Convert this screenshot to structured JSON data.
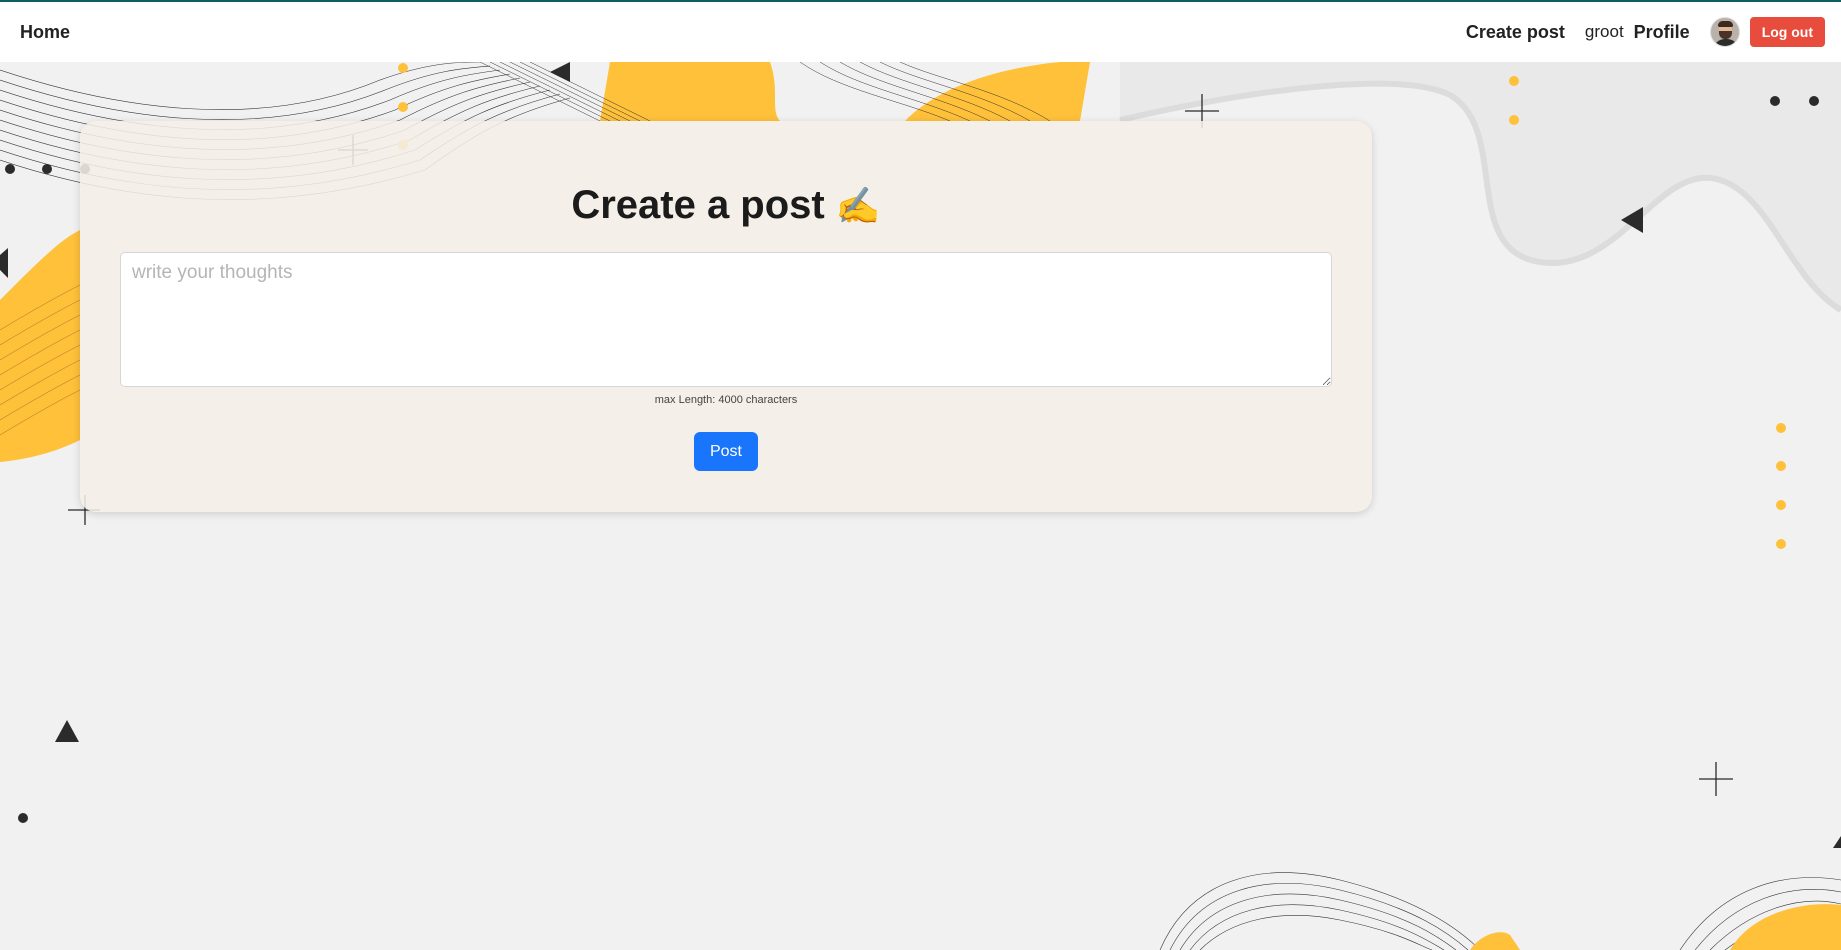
{
  "nav": {
    "home_label": "Home",
    "create_post_label": "Create post",
    "username": "groot",
    "profile_label": "Profile",
    "logout_label": "Log out"
  },
  "composer": {
    "title": "Create a post",
    "title_emoji": "✍",
    "textarea_placeholder": "write your thoughts",
    "textarea_value": "",
    "hint": "max Length: 4000 characters",
    "submit_label": "Post"
  },
  "theme": {
    "nav_border": "#0f5e64",
    "accent_yellow": "#ffc03a",
    "logout_red": "#e74c3c",
    "post_blue": "#1a75fd",
    "card_bg": "#f4eee6"
  },
  "icons": {
    "avatar": "user-avatar",
    "title_emoji": "writing-hand-icon"
  }
}
